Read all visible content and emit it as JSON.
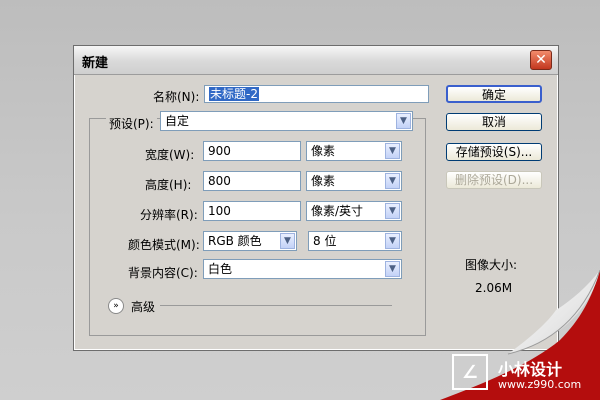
{
  "dialog": {
    "title": "新建",
    "name_label": "名称(N):",
    "name_value": "未标题-2",
    "preset_label": "预设(P):",
    "preset_value": "自定",
    "width_label": "宽度(W):",
    "width_value": "900",
    "width_unit": "像素",
    "height_label": "高度(H):",
    "height_value": "800",
    "height_unit": "像素",
    "resolution_label": "分辨率(R):",
    "resolution_value": "100",
    "resolution_unit": "像素/英寸",
    "color_mode_label": "颜色模式(M):",
    "color_mode_value": "RGB 颜色",
    "bit_depth_value": "8 位",
    "background_label": "背景内容(C):",
    "background_value": "白色",
    "advanced_label": "高级",
    "ok_label": "确定",
    "cancel_label": "取消",
    "save_preset_label": "存储预设(S)...",
    "delete_preset_label": "删除预设(D)...",
    "image_size_label": "图像大小:",
    "image_size_value": "2.06M"
  },
  "watermark": {
    "logo_glyph": "∠",
    "brand": "小林设计",
    "url": "www.z990.com"
  },
  "colors": {
    "accent_red": "#b40d0d",
    "dialog_bg": "#d6d3ce"
  }
}
